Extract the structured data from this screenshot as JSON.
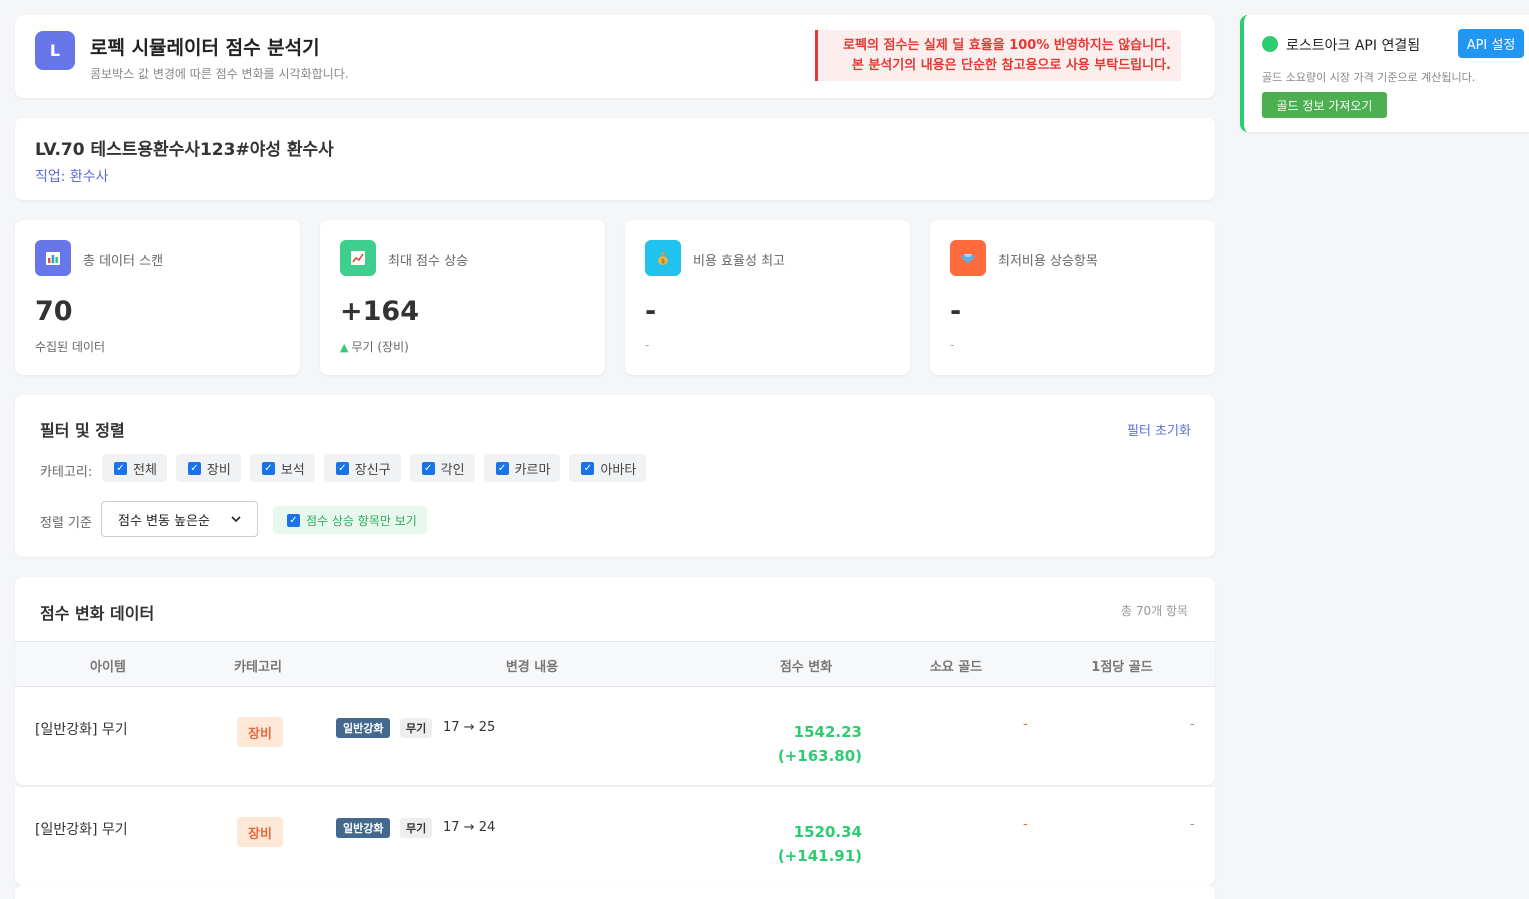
{
  "header": {
    "logo_letter": "L",
    "title": "로펙 시뮬레이터 점수 분석기",
    "subtitle": "콤보박스 값 변경에 따른 점수 변화를 시각화합니다.",
    "warning_line1": "로펙의 점수는 실제 딜 효율을 100% 반영하지는 않습니다.",
    "warning_line2": "본 분석기의 내용은 단순한 참고용으로 사용 부탁드립니다."
  },
  "api_panel": {
    "status": "로스트아크 API 연결됨",
    "settings_button": "API 설정",
    "note": "골드 소요량이 시장 가격 기준으로 계산됩니다.",
    "gold_button": "골드 정보 가져오기"
  },
  "character": {
    "name": "LV.70 테스트용환수사123#야성 환수사",
    "class_label": "직업: 환수사"
  },
  "stats": [
    {
      "icon": "bar-chart-icon",
      "label": "총 데이터 스캔",
      "value": "70",
      "sub": "수집된 데이터"
    },
    {
      "icon": "trend-up-icon",
      "label": "최대 점수 상승",
      "value": "+164",
      "sub": "무기 (장비)"
    },
    {
      "icon": "money-bag-icon",
      "label": "비용 효율성 최고",
      "value": "-",
      "sub": "-"
    },
    {
      "icon": "gem-icon",
      "label": "최저비용 상승항목",
      "value": "-",
      "sub": "-"
    }
  ],
  "filters": {
    "title": "필터 및 정렬",
    "reset": "필터 초기화",
    "category_label": "카테고리:",
    "categories": [
      "전체",
      "장비",
      "보석",
      "장신구",
      "각인",
      "카르마",
      "아바타"
    ],
    "sort_label": "정렬 기준",
    "sort_value": "점수 변동 높은순",
    "rise_only": "점수 상승 항목만 보기"
  },
  "table": {
    "title": "점수 변화 데이터",
    "count": "총 70개 항목",
    "columns": [
      "아이템",
      "카테고리",
      "변경 내용",
      "점수 변화",
      "소요 골드",
      "1점당 골드"
    ],
    "rows": [
      {
        "item": "[일반강화] 무기",
        "category": "장비",
        "tag1": "일반강화",
        "tag2": "무기",
        "change": "17 → 25",
        "score": "1542.23",
        "delta": "(+163.80)",
        "gold": "-",
        "per_point": "-"
      },
      {
        "item": "[일반강화] 무기",
        "category": "장비",
        "tag1": "일반강화",
        "tag2": "무기",
        "change": "17 → 24",
        "score": "1520.34",
        "delta": "(+141.91)",
        "gold": "-",
        "per_point": "-"
      }
    ]
  },
  "colors": {
    "accent": "#6777e8",
    "success": "#2ecc71",
    "danger": "#e53935",
    "api_button": "#2196f3",
    "gold_button": "#4caf50",
    "category_badge": "#e8683b"
  }
}
